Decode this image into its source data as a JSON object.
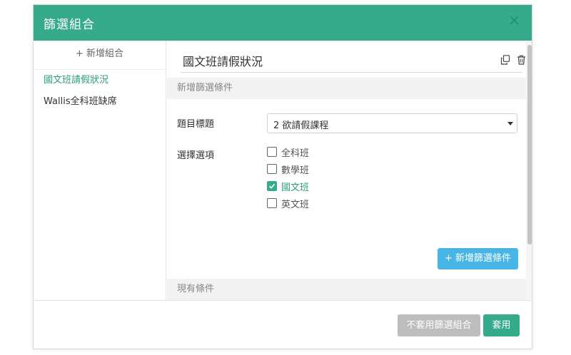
{
  "dialog": {
    "title": "篩選組合",
    "close_label": "×"
  },
  "sidebar": {
    "add_combo_label": "+ 新增組合",
    "items": [
      {
        "label": "國文班請假狀況",
        "active": true
      },
      {
        "label": "Wallis全科班缺席",
        "active": false
      }
    ]
  },
  "main": {
    "combo_name": "國文班請假狀況",
    "add_condition_section": "新增篩選條件",
    "question_label": "題目標題",
    "question_selected": "2 欲請假課程",
    "options_label": "選擇選項",
    "options": [
      {
        "label": "全科班",
        "checked": false
      },
      {
        "label": "數學班",
        "checked": false
      },
      {
        "label": "國文班",
        "checked": true
      },
      {
        "label": "英文班",
        "checked": false
      }
    ],
    "add_condition_button": "+ 新增篩選條件",
    "existing_section": "現有條件"
  },
  "footer": {
    "no_apply_button": "不套用篩選組合",
    "apply_button": "套用"
  },
  "icons": [
    "close-icon",
    "copy-icon",
    "trash-icon",
    "check-icon",
    "chevron-down-icon"
  ],
  "colors": {
    "header": "#35ab8c",
    "accent_text": "#2e9e7f",
    "info_button": "#47b6e6",
    "disabled_button": "#bdbdbd"
  }
}
